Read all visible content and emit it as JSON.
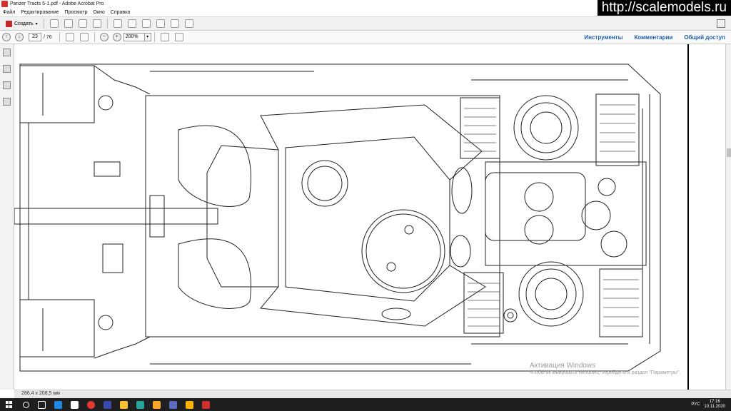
{
  "window": {
    "title": "Panzer Tracts 5-1.pdf - Adobe Acrobat Pro"
  },
  "site_watermark": "http://scalemodels.ru",
  "menu": [
    "Файл",
    "Редактирование",
    "Просмотр",
    "Окно",
    "Справка"
  ],
  "toolbar": {
    "create_label": "Создать"
  },
  "navigation": {
    "current_page": "23",
    "total_pages": "/ 76",
    "zoom": "200%"
  },
  "right_links": [
    "Инструменты",
    "Комментарии",
    "Общий доступ"
  ],
  "status": {
    "page_size": "286,4 x 208,5 мм"
  },
  "activation": {
    "title": "Активация Windows",
    "subtitle": "Чтобы активировать Windows, перейдите в раздел \"Параметры\"."
  },
  "taskbar": {
    "language": "РУС",
    "time": "17:16",
    "date": "10.11.2020"
  },
  "colors": {
    "link": "#1f5fa8",
    "taskbar": "#1f1f1f",
    "create_icon": "#c62828"
  }
}
